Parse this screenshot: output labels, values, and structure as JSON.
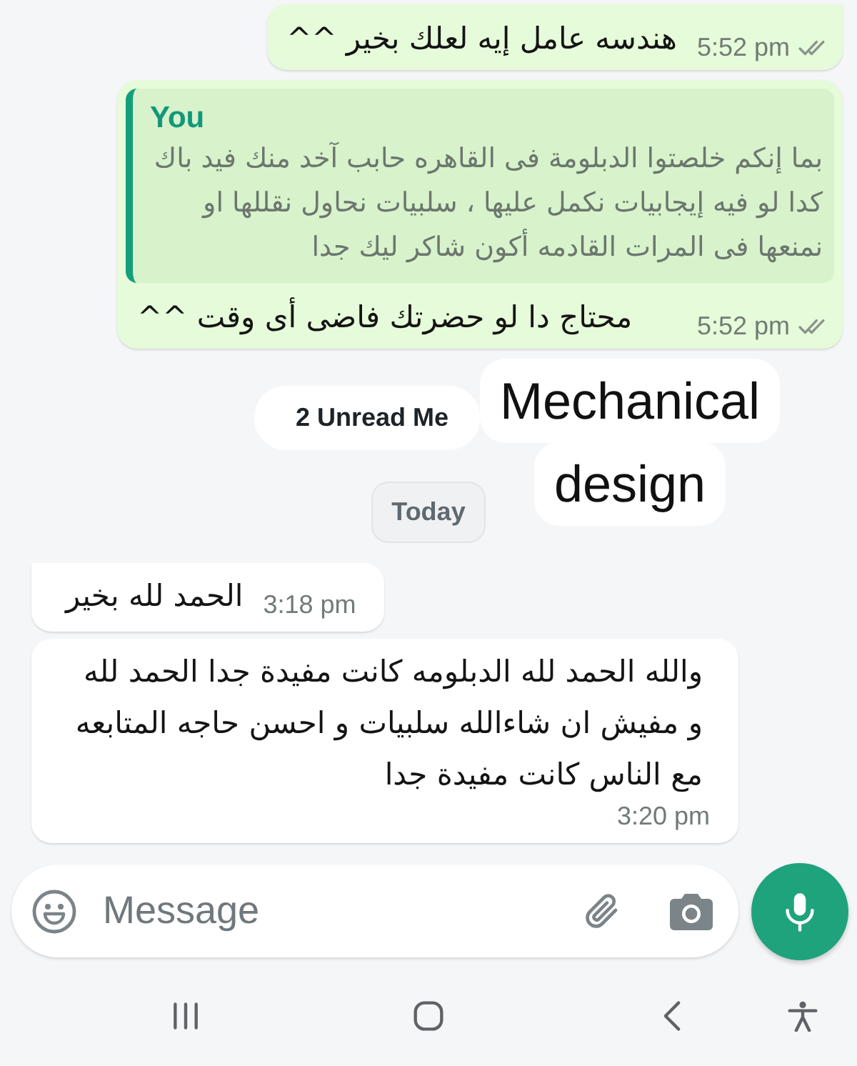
{
  "messages": [
    {
      "kind": "outgoing",
      "tail": true,
      "text": "هندسه عامل إيه لعلك بخير ^^",
      "time": "5:52 pm",
      "read": false
    },
    {
      "kind": "outgoing",
      "tail": false,
      "quote": {
        "author": "You",
        "text": "بما إنكم خلصتوا الدبلومة فى القاهره حابب آخد منك فيد باك كدا لو فيه إيجابيات نكمل عليها ، سلبيات نحاول نقللها او نمنعها فى المرات القادمه أكون شاكر ليك جدا"
      },
      "text": "محتاج دا لو حضرتك فاضى أى وقت ^^",
      "time": "5:52 pm",
      "read": false
    },
    {
      "kind": "unread_banner",
      "text": "2 Unread Me"
    },
    {
      "kind": "date_chip",
      "text": "Today"
    },
    {
      "kind": "incoming",
      "tail": true,
      "text": "الحمد لله بخير",
      "time": "3:18 pm"
    },
    {
      "kind": "incoming",
      "tail": false,
      "text": "والله الحمد لله الدبلومه كانت مفيدة جدا الحمد لله و مفيش ان شاءالله سلبيات و احسن حاجه المتابعه مع الناس كانت مفيدة جدا",
      "time": "3:20 pm"
    }
  ],
  "overlay_label": {
    "text": "Mechanical design"
  },
  "composer": {
    "placeholder": "Message"
  }
}
